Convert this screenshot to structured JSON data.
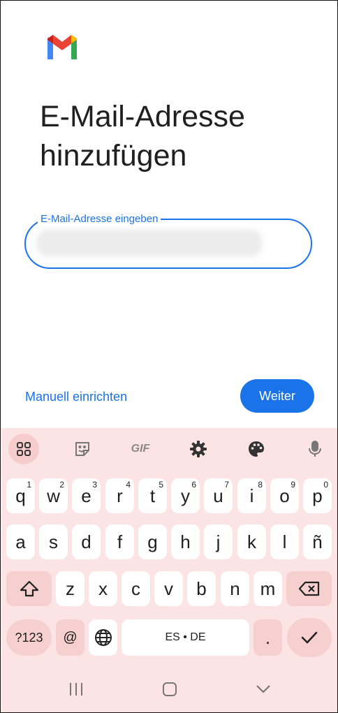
{
  "app": {
    "logo": "gmail-logo"
  },
  "header": {
    "title": "E-Mail-Adresse hinzufügen"
  },
  "email_field": {
    "label": "E-Mail-Adresse eingeben",
    "value": ""
  },
  "actions": {
    "manual_setup": "Manuell einrichten",
    "next": "Weiter"
  },
  "keyboard": {
    "toolbar": [
      "apps-grid-icon",
      "sticker-icon",
      "GIF",
      "gear-icon",
      "palette-icon",
      "microphone-icon"
    ],
    "row1": [
      [
        "q",
        "1"
      ],
      [
        "w",
        "2"
      ],
      [
        "e",
        "3"
      ],
      [
        "r",
        "4"
      ],
      [
        "t",
        "5"
      ],
      [
        "y",
        "6"
      ],
      [
        "u",
        "7"
      ],
      [
        "i",
        "8"
      ],
      [
        "o",
        "9"
      ],
      [
        "p",
        "0"
      ]
    ],
    "row2": [
      "a",
      "s",
      "d",
      "f",
      "g",
      "h",
      "j",
      "k",
      "l",
      "ñ"
    ],
    "row3": [
      "z",
      "x",
      "c",
      "v",
      "b",
      "n",
      "m"
    ],
    "row4": {
      "symbols": "?123",
      "at": "@",
      "space": "ES • DE",
      "period": "."
    },
    "colors": {
      "background": "#fce4e4",
      "function_key": "#f6cfcf",
      "accent": "#1a73e8"
    }
  },
  "navbar": [
    "recent-apps-icon",
    "home-icon",
    "back-icon"
  ]
}
